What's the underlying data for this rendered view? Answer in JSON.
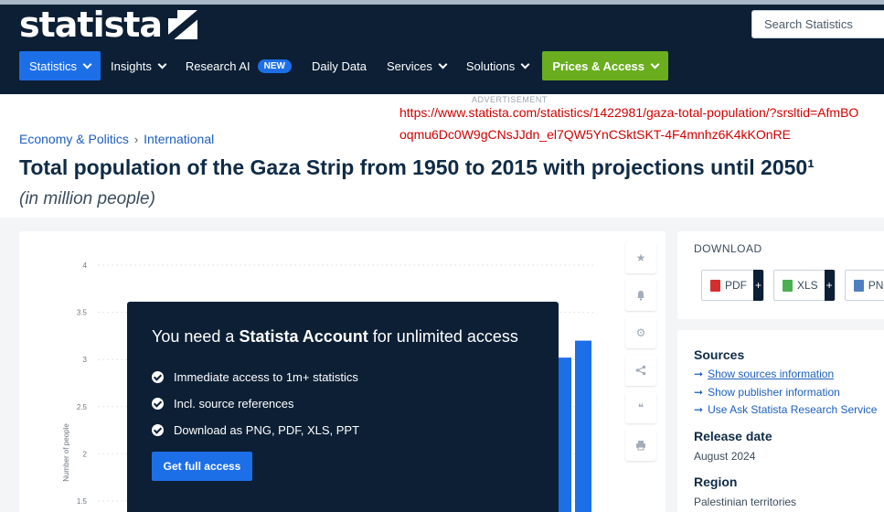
{
  "header": {
    "logo_text": "statista",
    "search_placeholder": "Search Statistics",
    "nav": [
      {
        "label": "Statistics"
      },
      {
        "label": "Insights"
      },
      {
        "label": "Research AI",
        "badge": "NEW"
      },
      {
        "label": "Daily Data"
      },
      {
        "label": "Services"
      },
      {
        "label": "Solutions"
      },
      {
        "label": "Prices & Access"
      }
    ]
  },
  "ad": {
    "label": "ADVERTISEMENT",
    "url_line1": "https://www.statista.com/statistics/1422981/gaza-total-population/?srsltid=AfmBO",
    "url_line2": "oqmu6Dc0W9gCNsJJdn_el7QW5YnCSktSKT-4F4mnhz6K4kKOnRE"
  },
  "breadcrumb": [
    "Economy & Politics",
    "International"
  ],
  "page": {
    "title": "Total population of the Gaza Strip from 1950 to 2015 with projections until 2050¹",
    "subtitle": "(in million people)"
  },
  "chart_data": {
    "type": "bar",
    "ylabel": "Number of people",
    "y_ticks": [
      "4",
      "3.5",
      "3",
      "2.5",
      "2",
      "1.5"
    ],
    "ylim": [
      1.5,
      4
    ],
    "visible_bars": [
      3.02,
      3.2
    ]
  },
  "paywall": {
    "title_pre": "You need a ",
    "title_bold": "Statista Account",
    "title_post": " for unlimited access",
    "items": [
      "Immediate access to 1m+ statistics",
      "Incl. source references",
      "Download as PNG, PDF, XLS, PPT"
    ],
    "cta": "Get full access"
  },
  "download": {
    "title": "DOWNLOAD",
    "buttons": [
      {
        "label": "PDF",
        "color": "#d32f2f"
      },
      {
        "label": "XLS",
        "color": "#4caf50"
      },
      {
        "label": "PNG",
        "color": "#4f7fc1"
      }
    ]
  },
  "sources": {
    "title": "Sources",
    "links": [
      "Show sources information",
      "Show publisher information",
      "Use Ask Statista Research Service"
    ],
    "release_title": "Release date",
    "release_value": "August 2024",
    "region_title": "Region",
    "region_value": "Palestinian territories"
  }
}
